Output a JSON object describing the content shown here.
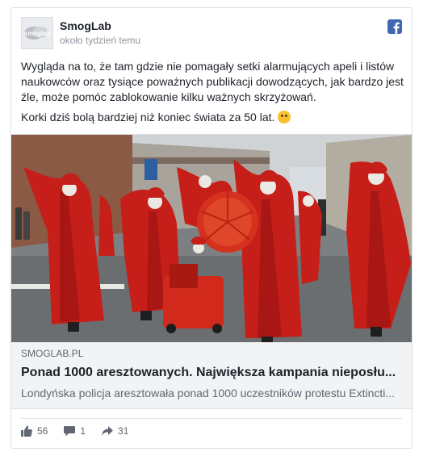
{
  "post": {
    "page_name": "SmogLab",
    "timestamp": "około tydzień temu",
    "avatar_text": "smoglab",
    "paragraphs": [
      "Wygląda na to, że tam gdzie nie pomagały setki alarmujących apeli i listów naukowców oraz tysiące poważnych publikacji dowodzących, jak bardzo jest źle, może pomóc zablokowanie kilku ważnych skrzyżowań.",
      "Korki dziś bolą bardziej niż koniec świata za 50 lat."
    ],
    "emoji": "wink-face"
  },
  "link": {
    "domain": "SMOGLAB.PL",
    "title": "Ponad 1000 aresztowanych. Największa kampania nieposłu...",
    "description": "Londyńska policja aresztowała ponad 1000 uczestników protestu Extincti...",
    "image_subject": "street protest with performers in red robes"
  },
  "stats": {
    "likes": "56",
    "comments": "1",
    "shares": "31"
  },
  "colors": {
    "facebook_blue": "#4267b2",
    "robe_red": "#c61f1a",
    "meta_gray": "#90949c"
  }
}
